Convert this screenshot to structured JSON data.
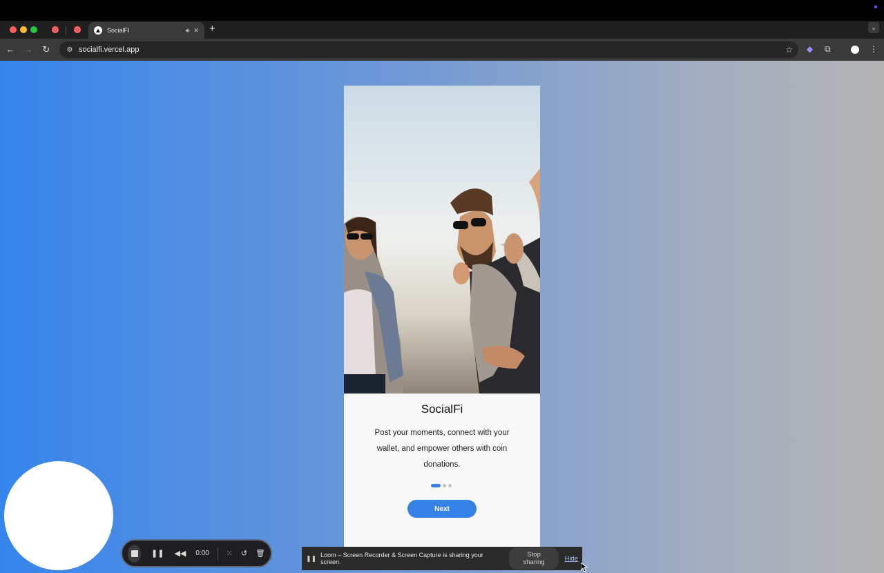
{
  "browser": {
    "tab_title": "SocialFI",
    "url": "socialfi.vercel.app"
  },
  "app": {
    "title": "SocialFi",
    "description": "Post your moments, connect with your wallet, and empower others with coin donations.",
    "next_label": "Next",
    "pager": {
      "total": 3,
      "active": 1
    },
    "accent": "#3581e6"
  },
  "recorder": {
    "time": "0:00"
  },
  "share_bar": {
    "message": "Loom – Screen Recorder & Screen Capture is sharing your screen.",
    "stop_label": "Stop sharing",
    "hide_label": "Hide"
  }
}
